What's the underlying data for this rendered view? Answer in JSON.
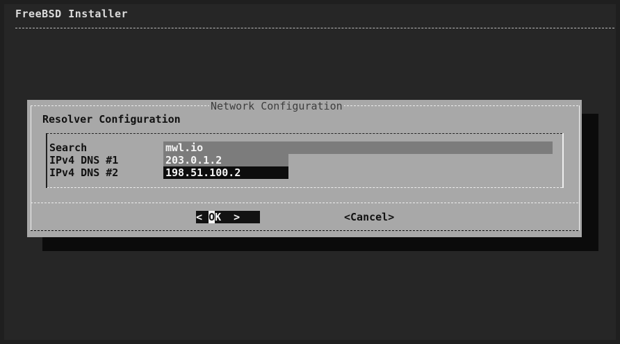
{
  "app": {
    "title": "FreeBSD Installer"
  },
  "dialog": {
    "title": "Network Configuration",
    "subtitle": "Resolver Configuration",
    "fields": [
      {
        "label": "Search",
        "value": "mwl.io"
      },
      {
        "label": "IPv4 DNS #1",
        "value": "203.0.1.2"
      },
      {
        "label": "IPv4 DNS #2",
        "value": "198.51.100.2"
      }
    ],
    "buttons": {
      "ok_left": "< ",
      "ok_hotkey": "O",
      "ok_rest": "K  >",
      "cancel": "<Cancel>"
    }
  }
}
